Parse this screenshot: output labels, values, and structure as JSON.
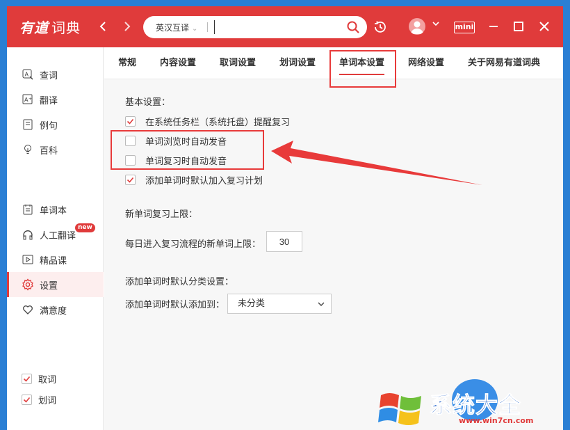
{
  "titlebar": {
    "logo_main": "有道",
    "logo_sub": "词典",
    "back_label": "‹",
    "forward_label": "›",
    "lang_select": "英汉互译",
    "search_placeholder": "",
    "mini_label": "mini"
  },
  "sidebar": {
    "items": [
      {
        "label": "查词",
        "icon": "search-word-icon"
      },
      {
        "label": "翻译",
        "icon": "translate-icon"
      },
      {
        "label": "例句",
        "icon": "example-icon"
      },
      {
        "label": "百科",
        "icon": "encyclopedia-icon"
      },
      {
        "label": "单词本",
        "icon": "wordbook-icon"
      },
      {
        "label": "人工翻译",
        "icon": "human-translate-icon",
        "badge": "new"
      },
      {
        "label": "精品课",
        "icon": "course-icon"
      },
      {
        "label": "设置",
        "icon": "settings-icon",
        "active": true
      },
      {
        "label": "满意度",
        "icon": "heart-icon"
      }
    ],
    "toggles": [
      {
        "label": "取词",
        "checked": true
      },
      {
        "label": "划词",
        "checked": true
      }
    ]
  },
  "tabs": [
    {
      "label": "常规"
    },
    {
      "label": "内容设置"
    },
    {
      "label": "取词设置"
    },
    {
      "label": "划词设置"
    },
    {
      "label": "单词本设置",
      "active": true
    },
    {
      "label": "网络设置"
    },
    {
      "label": "关于网易有道词典"
    }
  ],
  "content": {
    "basic_title": "基本设置：",
    "options": [
      {
        "label": "在系统任务栏（系统托盘）提醒复习",
        "checked": true
      },
      {
        "label": "单词浏览时自动发音",
        "checked": false
      },
      {
        "label": "单词复习时自动发音",
        "checked": false
      },
      {
        "label": "添加单词时默认加入复习计划",
        "checked": true
      }
    ],
    "limit_title": "新单词复习上限：",
    "limit_label": "每日进入复习流程的新单词上限：",
    "limit_value": "30",
    "category_title": "添加单词时默认分类设置：",
    "category_label": "添加单词时默认添加到：",
    "category_value": "未分类"
  },
  "watermark": {
    "text": "系统大全",
    "url": "www.win7cn.com"
  },
  "colors": {
    "accent": "#e03b3b",
    "annotation": "#e83a3a",
    "desktop": "#2a7fd4"
  }
}
